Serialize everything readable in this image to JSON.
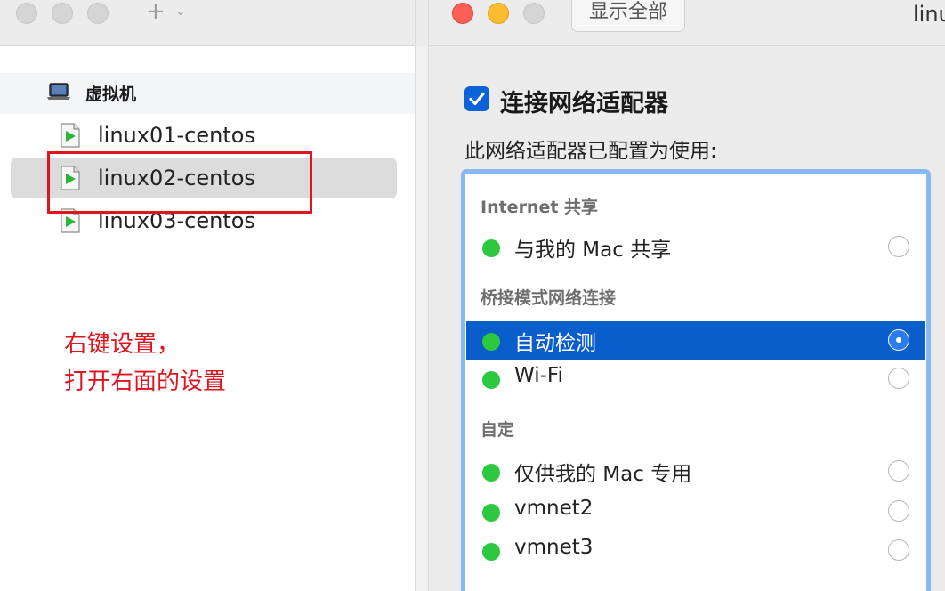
{
  "left_window": {
    "traffic_lights": [
      "inactive-close",
      "inactive-minimize",
      "inactive-zoom"
    ],
    "toolbar": {
      "add_icon": "+",
      "add_menu_icon": "⌄"
    },
    "group": {
      "icon": "laptop-icon",
      "label": "虚拟机"
    },
    "vms": [
      {
        "label": "linux01-centos",
        "icon": "vm-file-icon",
        "selected": false
      },
      {
        "label": "linux02-centos",
        "icon": "vm-file-icon",
        "selected": true
      },
      {
        "label": "linux03-centos",
        "icon": "vm-file-icon",
        "selected": false
      }
    ],
    "annotation": {
      "line1": "右键设置，",
      "line2": "打开右面的设置",
      "color": "#e0141e"
    }
  },
  "right_window": {
    "traffic_lights": {
      "close": "#fe5f57",
      "minimize": "#febc2e",
      "zoom": "#d5d5d5"
    },
    "show_all_button": "显示全部",
    "title": "linu",
    "connect_checkbox": {
      "checked": true,
      "label": "连接网络适配器"
    },
    "config_label": "此网络适配器已配置为使用:",
    "sections": [
      {
        "header": "Internet 共享",
        "items": [
          {
            "label": "与我的 Mac 共享",
            "selected": false
          }
        ]
      },
      {
        "header": "桥接模式网络连接",
        "items": [
          {
            "label": "自动检测",
            "selected": true
          },
          {
            "label": "Wi-Fi",
            "selected": false
          }
        ]
      },
      {
        "header": "自定",
        "items": [
          {
            "label": "仅供我的 Mac 专用",
            "selected": false
          },
          {
            "label": "vmnet2",
            "selected": false
          },
          {
            "label": "vmnet3",
            "selected": false
          }
        ]
      }
    ],
    "status_dot_color": "#2bc840",
    "accent": "#0a5ecb"
  }
}
